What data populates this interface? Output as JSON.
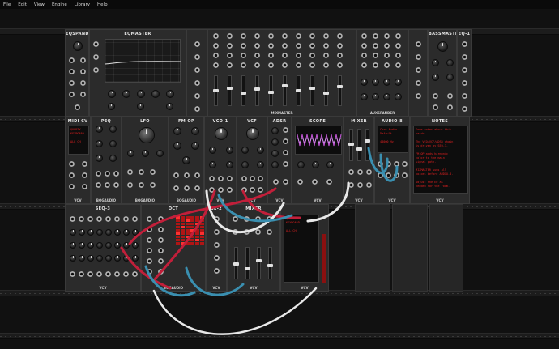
{
  "menu": [
    "File",
    "Edit",
    "View",
    "Engine",
    "Library",
    "Help"
  ],
  "modules": {
    "eqspander": "EQSPANDER",
    "eqmaster": "EQMASTER",
    "mixmaster": "MIXMASTER",
    "auxspander": "AUXSPANDER",
    "bassmaster": "BASSMASTER",
    "eq1": "EQ-1",
    "midicv": "MIDI-CV",
    "peq": "PEQ",
    "lfo": "LFO",
    "fmop": "FM-OP",
    "vco1": "VCO-1",
    "vcf": "VCF",
    "adsr": "ADSR",
    "scope": "SCOPE",
    "mixer": "MIXER",
    "audio8": "AUDIO-8",
    "notes": "NOTES",
    "seq3": "SEQ-3",
    "octal": "OCT",
    "bogaudio": "BOGAUDIO",
    "vcv": "VCV",
    "mixer2": "MIXER",
    "sh2": "SE-2"
  },
  "notes_text": "Some notes about this\npatch.\n\nThe VCO/VCF/ADSR chain\nis driven by SEQ-3.\n\nFM-OP adds harmonic\ncolor to the main\nsignal path.\n\nMIXMASTER sums all\nvoices before AUDIO-8.\n\nAdjust the EQ as\nneeded for the room.",
  "midi_screen": "QUERTY\nKEYBOARD\n\nALL CH",
  "audio_screen": "Core Audio\nDefault\n\n48000 Hz",
  "scope_label": "SCOPE",
  "cable_colors": {
    "red": "#c21f3a",
    "blue": "#3a8fb0",
    "white": "#e8e8e8"
  },
  "icons": {
    "vcv_logo": "vcv-logo-icon"
  }
}
